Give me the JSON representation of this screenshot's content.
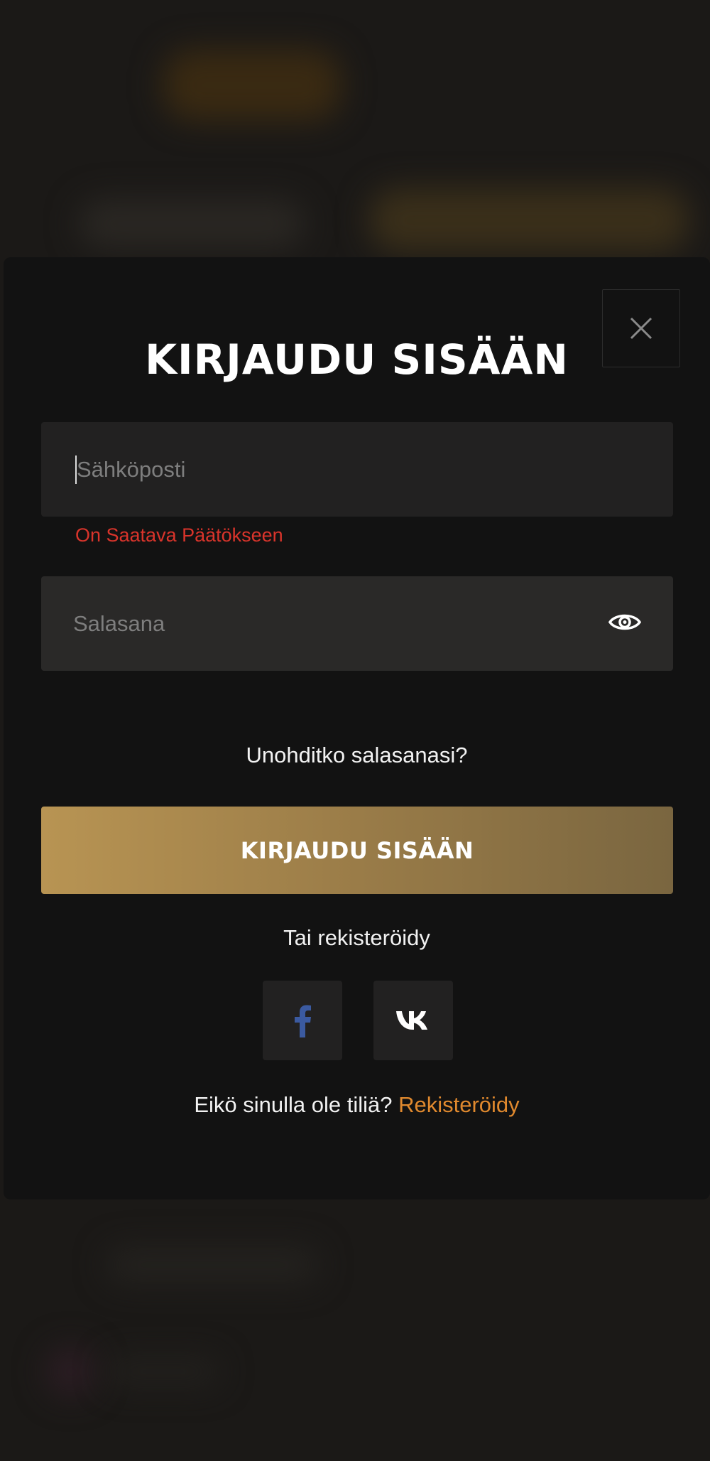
{
  "modal": {
    "title": "KIRJAUDU SISÄÄN",
    "email": {
      "placeholder": "Sähköposti",
      "value": "",
      "error": "On Saatava Päätökseen"
    },
    "password": {
      "placeholder": "Salasana",
      "value": ""
    },
    "forgot_link": "Unohditko salasanasi?",
    "submit_label": "KIRJAUDU SISÄÄN",
    "or_register": "Tai rekisteröidy",
    "social": [
      {
        "name": "facebook",
        "icon": "facebook-icon"
      },
      {
        "name": "vk",
        "icon": "vk-icon"
      }
    ],
    "signup_prompt": "Eikö sinulla ole tiliä?",
    "signup_link": "Rekisteröidy"
  },
  "colors": {
    "background": "#121212",
    "field": "#222121",
    "accent_gold": "#b89453",
    "error": "#d9342b",
    "link_orange": "#e0892e",
    "facebook_blue": "#3b5aa0"
  }
}
